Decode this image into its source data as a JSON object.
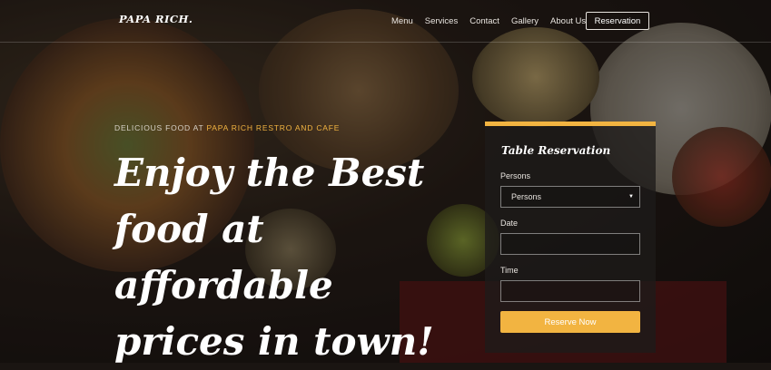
{
  "brand": "PAPA RICH.",
  "nav": {
    "items": [
      "Menu",
      "Services",
      "Contact",
      "Gallery",
      "About Us"
    ],
    "cta": "Reservation"
  },
  "hero": {
    "tagline_prefix": "DELICIOUS FOOD AT ",
    "tagline_highlight": "PAPA RICH RESTRO AND CAFE",
    "headline_line1": "Enjoy the Best",
    "headline_line2": "food at affordable",
    "headline_line3": "prices in town!"
  },
  "reservation": {
    "title": "Table Reservation",
    "persons_label": "Persons",
    "persons_value": "Persons",
    "date_label": "Date",
    "date_value": "",
    "time_label": "Time",
    "time_value": "",
    "submit": "Reserve Now"
  },
  "colors": {
    "accent": "#f2b441",
    "text": "#ffffff"
  }
}
